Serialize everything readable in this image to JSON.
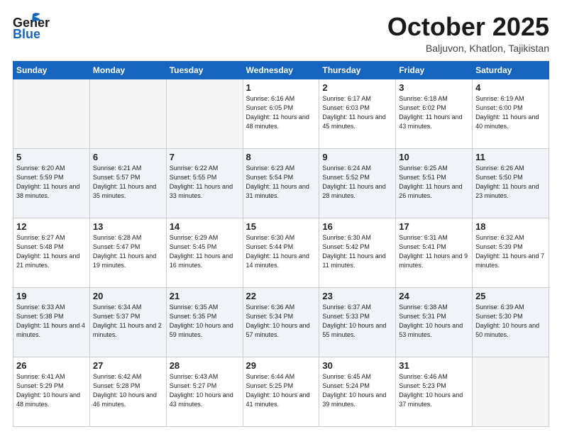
{
  "header": {
    "logo_general": "General",
    "logo_blue": "Blue",
    "month": "October 2025",
    "location": "Baljuvon, Khatlon, Tajikistan"
  },
  "weekdays": [
    "Sunday",
    "Monday",
    "Tuesday",
    "Wednesday",
    "Thursday",
    "Friday",
    "Saturday"
  ],
  "weeks": [
    [
      {
        "day": "",
        "info": ""
      },
      {
        "day": "",
        "info": ""
      },
      {
        "day": "",
        "info": ""
      },
      {
        "day": "1",
        "info": "Sunrise: 6:16 AM\nSunset: 6:05 PM\nDaylight: 11 hours\nand 48 minutes."
      },
      {
        "day": "2",
        "info": "Sunrise: 6:17 AM\nSunset: 6:03 PM\nDaylight: 11 hours\nand 45 minutes."
      },
      {
        "day": "3",
        "info": "Sunrise: 6:18 AM\nSunset: 6:02 PM\nDaylight: 11 hours\nand 43 minutes."
      },
      {
        "day": "4",
        "info": "Sunrise: 6:19 AM\nSunset: 6:00 PM\nDaylight: 11 hours\nand 40 minutes."
      }
    ],
    [
      {
        "day": "5",
        "info": "Sunrise: 6:20 AM\nSunset: 5:59 PM\nDaylight: 11 hours\nand 38 minutes."
      },
      {
        "day": "6",
        "info": "Sunrise: 6:21 AM\nSunset: 5:57 PM\nDaylight: 11 hours\nand 35 minutes."
      },
      {
        "day": "7",
        "info": "Sunrise: 6:22 AM\nSunset: 5:55 PM\nDaylight: 11 hours\nand 33 minutes."
      },
      {
        "day": "8",
        "info": "Sunrise: 6:23 AM\nSunset: 5:54 PM\nDaylight: 11 hours\nand 31 minutes."
      },
      {
        "day": "9",
        "info": "Sunrise: 6:24 AM\nSunset: 5:52 PM\nDaylight: 11 hours\nand 28 minutes."
      },
      {
        "day": "10",
        "info": "Sunrise: 6:25 AM\nSunset: 5:51 PM\nDaylight: 11 hours\nand 26 minutes."
      },
      {
        "day": "11",
        "info": "Sunrise: 6:26 AM\nSunset: 5:50 PM\nDaylight: 11 hours\nand 23 minutes."
      }
    ],
    [
      {
        "day": "12",
        "info": "Sunrise: 6:27 AM\nSunset: 5:48 PM\nDaylight: 11 hours\nand 21 minutes."
      },
      {
        "day": "13",
        "info": "Sunrise: 6:28 AM\nSunset: 5:47 PM\nDaylight: 11 hours\nand 19 minutes."
      },
      {
        "day": "14",
        "info": "Sunrise: 6:29 AM\nSunset: 5:45 PM\nDaylight: 11 hours\nand 16 minutes."
      },
      {
        "day": "15",
        "info": "Sunrise: 6:30 AM\nSunset: 5:44 PM\nDaylight: 11 hours\nand 14 minutes."
      },
      {
        "day": "16",
        "info": "Sunrise: 6:30 AM\nSunset: 5:42 PM\nDaylight: 11 hours\nand 11 minutes."
      },
      {
        "day": "17",
        "info": "Sunrise: 6:31 AM\nSunset: 5:41 PM\nDaylight: 11 hours\nand 9 minutes."
      },
      {
        "day": "18",
        "info": "Sunrise: 6:32 AM\nSunset: 5:39 PM\nDaylight: 11 hours\nand 7 minutes."
      }
    ],
    [
      {
        "day": "19",
        "info": "Sunrise: 6:33 AM\nSunset: 5:38 PM\nDaylight: 11 hours\nand 4 minutes."
      },
      {
        "day": "20",
        "info": "Sunrise: 6:34 AM\nSunset: 5:37 PM\nDaylight: 11 hours\nand 2 minutes."
      },
      {
        "day": "21",
        "info": "Sunrise: 6:35 AM\nSunset: 5:35 PM\nDaylight: 10 hours\nand 59 minutes."
      },
      {
        "day": "22",
        "info": "Sunrise: 6:36 AM\nSunset: 5:34 PM\nDaylight: 10 hours\nand 57 minutes."
      },
      {
        "day": "23",
        "info": "Sunrise: 6:37 AM\nSunset: 5:33 PM\nDaylight: 10 hours\nand 55 minutes."
      },
      {
        "day": "24",
        "info": "Sunrise: 6:38 AM\nSunset: 5:31 PM\nDaylight: 10 hours\nand 53 minutes."
      },
      {
        "day": "25",
        "info": "Sunrise: 6:39 AM\nSunset: 5:30 PM\nDaylight: 10 hours\nand 50 minutes."
      }
    ],
    [
      {
        "day": "26",
        "info": "Sunrise: 6:41 AM\nSunset: 5:29 PM\nDaylight: 10 hours\nand 48 minutes."
      },
      {
        "day": "27",
        "info": "Sunrise: 6:42 AM\nSunset: 5:28 PM\nDaylight: 10 hours\nand 46 minutes."
      },
      {
        "day": "28",
        "info": "Sunrise: 6:43 AM\nSunset: 5:27 PM\nDaylight: 10 hours\nand 43 minutes."
      },
      {
        "day": "29",
        "info": "Sunrise: 6:44 AM\nSunset: 5:25 PM\nDaylight: 10 hours\nand 41 minutes."
      },
      {
        "day": "30",
        "info": "Sunrise: 6:45 AM\nSunset: 5:24 PM\nDaylight: 10 hours\nand 39 minutes."
      },
      {
        "day": "31",
        "info": "Sunrise: 6:46 AM\nSunset: 5:23 PM\nDaylight: 10 hours\nand 37 minutes."
      },
      {
        "day": "",
        "info": ""
      }
    ]
  ]
}
